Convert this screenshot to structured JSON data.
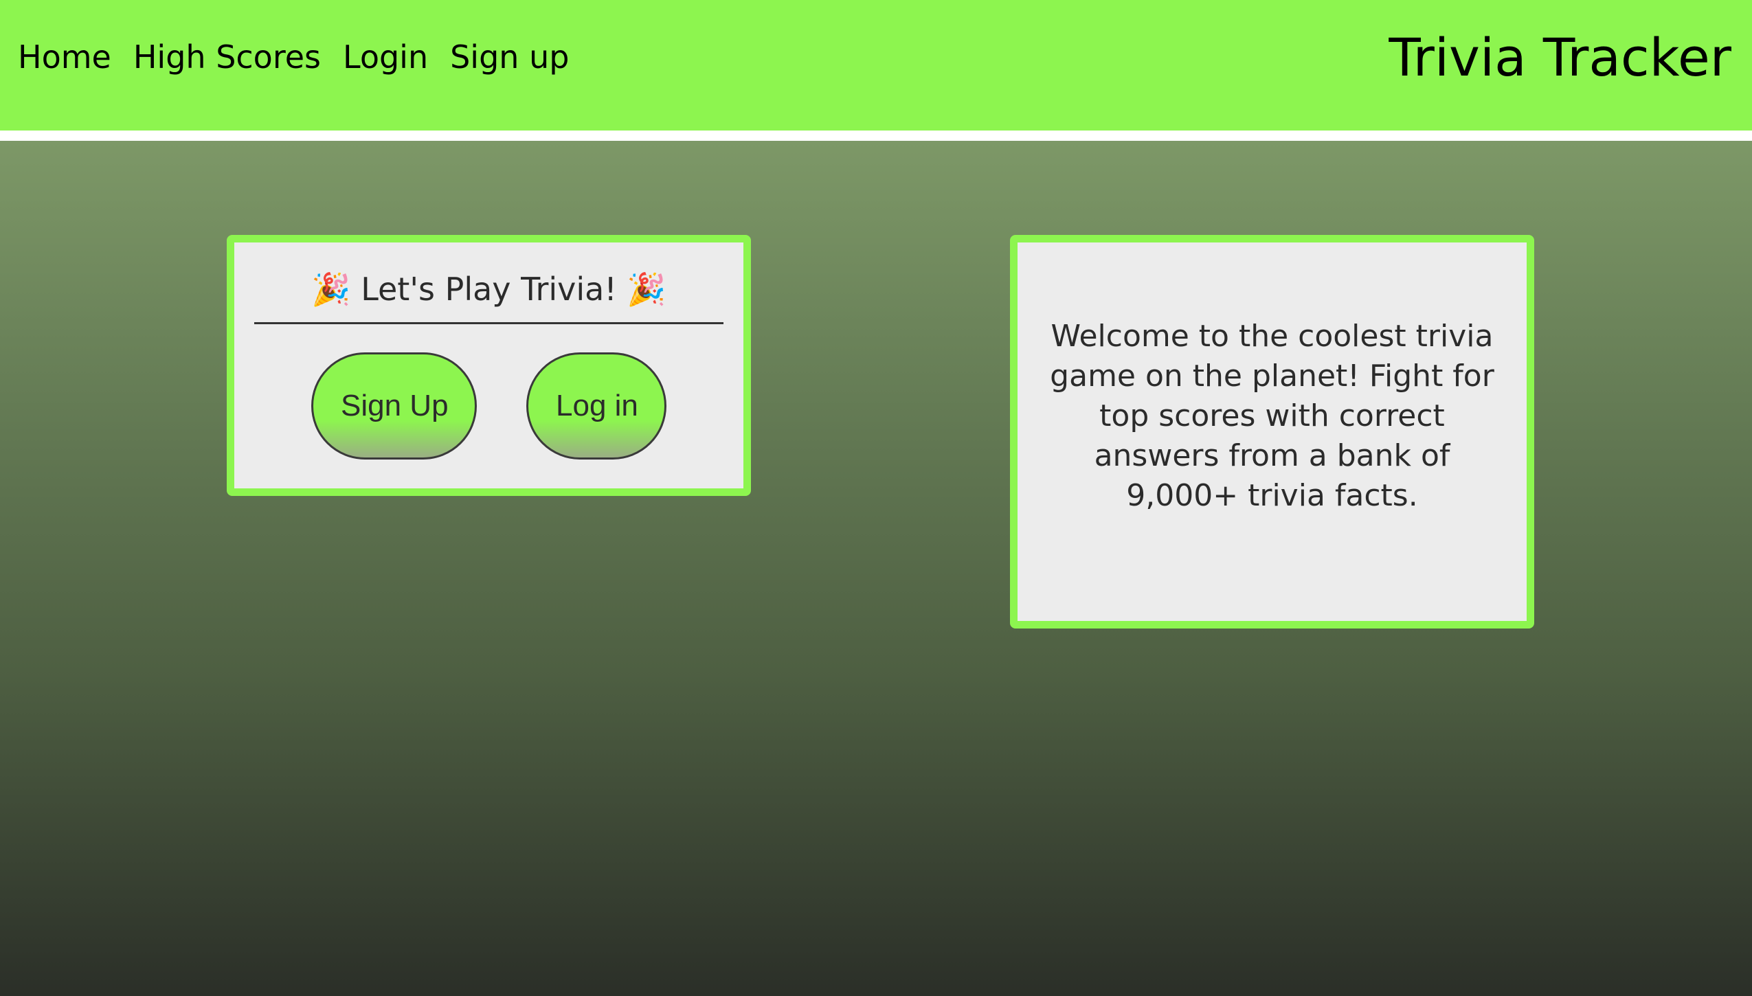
{
  "nav": {
    "links": [
      {
        "label": "Home"
      },
      {
        "label": "High Scores"
      },
      {
        "label": "Login"
      },
      {
        "label": "Sign up"
      }
    ],
    "brand": "Trivia Tracker"
  },
  "play_card": {
    "title": "Let's Play Trivia!",
    "title_icon": "party-popper-icon",
    "title_emoji": "🎉",
    "signup_label": "Sign Up",
    "login_label": "Log in"
  },
  "welcome_card": {
    "text": "Welcome to the coolest trivia game on the planet! Fight for top scores with correct answers from a bank of 9,000+ trivia facts."
  },
  "colors": {
    "accent": "#8df54f",
    "card_background": "#ececec",
    "text": "#2b2b2b",
    "gradient_top": "#7d9867",
    "gradient_bottom": "#2b2f28"
  }
}
